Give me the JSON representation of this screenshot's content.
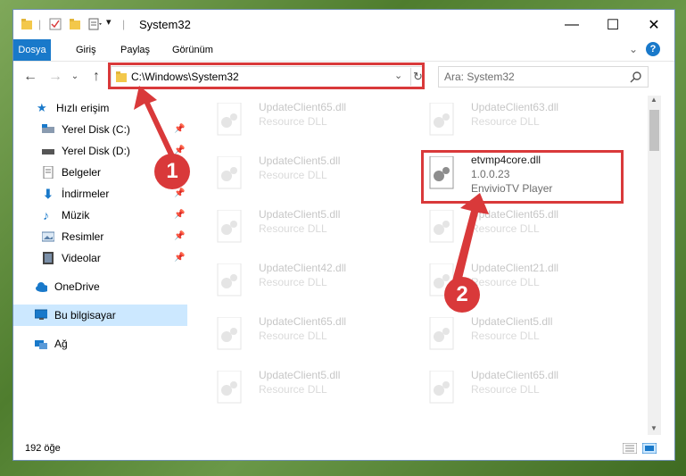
{
  "window": {
    "title": "System32"
  },
  "ribbon": {
    "tabs": [
      "Dosya",
      "Giriş",
      "Paylaş",
      "Görünüm"
    ]
  },
  "address": {
    "path": "C:\\Windows\\System32"
  },
  "search": {
    "placeholder": "Ara: System32"
  },
  "nav": {
    "quick_access": "Hızlı erişim",
    "items": [
      "Yerel Disk (C:)",
      "Yerel Disk (D:)",
      "Belgeler",
      "İndirmeler",
      "Müzik",
      "Resimler",
      "Videolar"
    ],
    "onedrive": "OneDrive",
    "this_pc": "Bu bilgisayar",
    "network": "Ağ"
  },
  "files": {
    "left": [
      {
        "name": "UpdateClient65.dll",
        "desc": "Resource DLL"
      },
      {
        "name": "UpdateClient5.dll",
        "desc": "Resource DLL"
      },
      {
        "name": "UpdateClient5.dll",
        "desc": "Resource DLL"
      },
      {
        "name": "UpdateClient42.dll",
        "desc": "Resource DLL"
      },
      {
        "name": "UpdateClient65.dll",
        "desc": "Resource DLL"
      },
      {
        "name": "UpdateClient5.dll",
        "desc": "Resource DLL"
      }
    ],
    "right": [
      {
        "name": "UpdateClient63.dll",
        "desc": "Resource DLL"
      },
      {
        "name": "UpdateClient65.dll",
        "desc": "Resource DLL"
      },
      {
        "name": "UpdateClient21.dll",
        "desc": "Resource DLL"
      },
      {
        "name": "UpdateClient5.dll",
        "desc": "Resource DLL"
      },
      {
        "name": "UpdateClient65.dll",
        "desc": "Resource DLL"
      }
    ],
    "highlighted": {
      "name": "etvmp4core.dll",
      "version": "1.0.0.23",
      "product": "EnvivioTV Player"
    }
  },
  "status": {
    "count": "192 öğe"
  },
  "callouts": [
    "1",
    "2"
  ],
  "colors": {
    "accent": "#1979ca",
    "highlight": "#d9393a",
    "selected": "#cce8ff"
  }
}
